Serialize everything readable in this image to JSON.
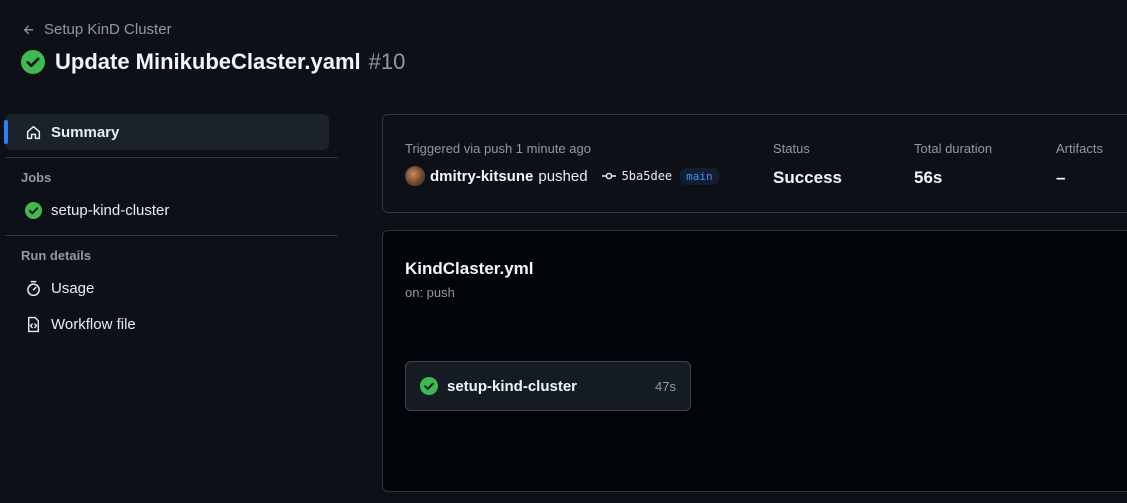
{
  "header": {
    "back_label": "Setup KinD Cluster",
    "title": "Update MinikubeClaster.yaml",
    "run_number": "#10"
  },
  "sidebar": {
    "summary_label": "Summary",
    "jobs_heading": "Jobs",
    "jobs": [
      {
        "label": "setup-kind-cluster",
        "status": "success"
      }
    ],
    "run_details_heading": "Run details",
    "usage_label": "Usage",
    "workflow_file_label": "Workflow file"
  },
  "summary": {
    "trigger_text": "Triggered via push 1 minute ago",
    "actor": "dmitry-kitsune",
    "action": "pushed",
    "commit_sha": "5ba5dee",
    "branch": "main",
    "status_label": "Status",
    "status_value": "Success",
    "duration_label": "Total duration",
    "duration_value": "56s",
    "artifacts_label": "Artifacts",
    "artifacts_value": "–"
  },
  "workflow": {
    "file_name": "KindClaster.yml",
    "trigger": "on: push",
    "job": {
      "name": "setup-kind-cluster",
      "duration": "47s"
    }
  },
  "colors": {
    "background": "#0d1117",
    "success": "#3fb950",
    "accent": "#2f81f7",
    "border": "#30363d"
  }
}
